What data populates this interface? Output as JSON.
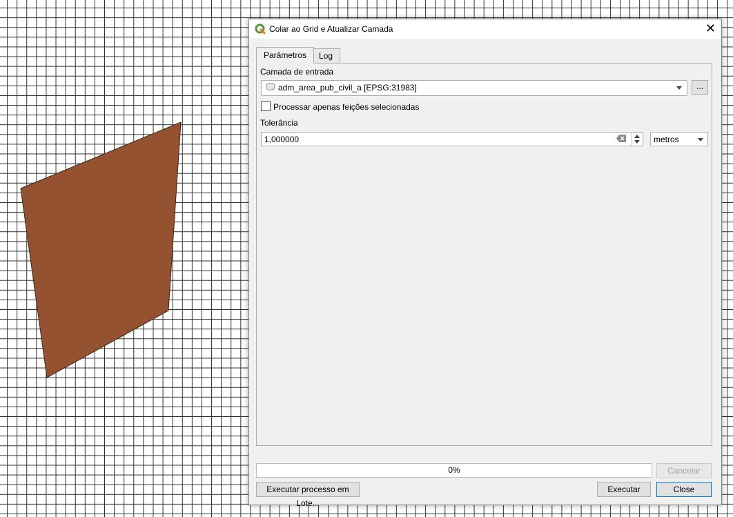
{
  "map": {
    "polygon_fill": "#955230",
    "polygon_stroke": "#3a2413"
  },
  "dialog": {
    "title": "Colar ao Grid e Atualizar Camada",
    "icon": "qgis-logo-icon",
    "close_symbol": "✕",
    "tabs": [
      {
        "label": "Parâmetros",
        "active": true
      },
      {
        "label": "Log",
        "active": false
      }
    ],
    "input_layer": {
      "label": "Camada de entrada",
      "value": "adm_area_pub_civil_a [EPSG:31983]",
      "icon": "polygon-layer-icon",
      "browse_label": "..."
    },
    "selected_only": {
      "label": "Processar apenas feições selecionadas",
      "checked": false
    },
    "tolerance": {
      "label": "Tolerância",
      "value": "1,000000",
      "unit": "metros"
    },
    "progress": {
      "text": "0%",
      "value": 0
    },
    "buttons": {
      "cancel": "Cancelar",
      "batch": "Executar processo em Lote...",
      "run": "Executar",
      "close": "Close"
    }
  }
}
